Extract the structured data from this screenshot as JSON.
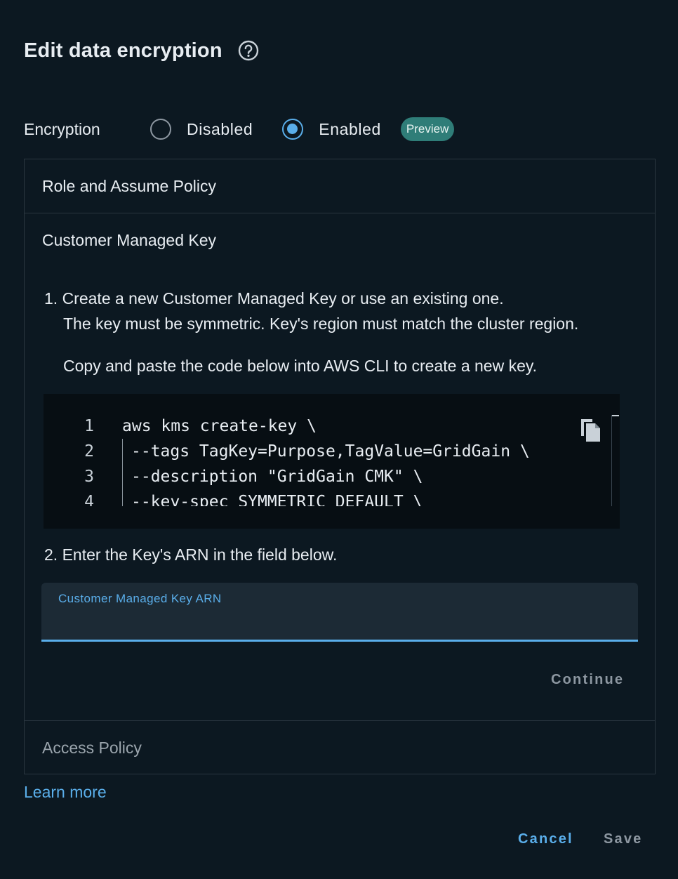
{
  "dialog": {
    "title": "Edit data encryption",
    "help_icon": "help-circle-icon"
  },
  "encryption": {
    "label": "Encryption",
    "options": [
      {
        "label": "Disabled",
        "selected": false
      },
      {
        "label": "Enabled",
        "selected": true
      }
    ],
    "badge": "Preview"
  },
  "sections": {
    "role": "Role and Assume Policy",
    "cmk": "Customer Managed Key",
    "access": "Access Policy"
  },
  "cmk_step1": {
    "line1": "1. Create a new Customer Managed Key or use an existing one.",
    "line2": "The key must be symmetric. Key's region must match the cluster region.",
    "line3": "Copy and paste the code below into AWS CLI to create a new key."
  },
  "code": {
    "copy_icon": "copy-icon",
    "lines": [
      {
        "num": "1",
        "text": "aws kms create-key \\"
      },
      {
        "num": "2",
        "text": "--tags TagKey=Purpose,TagValue=GridGain \\"
      },
      {
        "num": "3",
        "text": "--description \"GridGain CMK\" \\"
      },
      {
        "num": "4",
        "text": "--key-spec SYMMETRIC_DEFAULT \\"
      }
    ]
  },
  "cmk_step2": "2. Enter the Key's ARN in the field below.",
  "arn_field": {
    "label": "Customer Managed Key ARN",
    "value": ""
  },
  "buttons": {
    "continue": "Continue",
    "cancel": "Cancel",
    "save": "Save"
  },
  "links": {
    "learn_more": "Learn more"
  },
  "colors": {
    "background": "#0c1821",
    "accent": "#5aaeea",
    "badge": "#2f7d78",
    "muted": "#8d97a1"
  }
}
